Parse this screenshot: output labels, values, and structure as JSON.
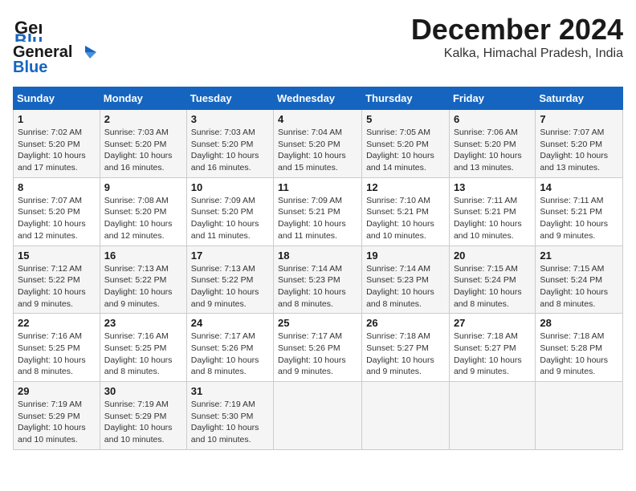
{
  "header": {
    "logo_line1": "General",
    "logo_line2": "Blue",
    "month": "December 2024",
    "location": "Kalka, Himachal Pradesh, India"
  },
  "weekdays": [
    "Sunday",
    "Monday",
    "Tuesday",
    "Wednesday",
    "Thursday",
    "Friday",
    "Saturday"
  ],
  "weeks": [
    [
      {
        "day": "1",
        "info": "Sunrise: 7:02 AM\nSunset: 5:20 PM\nDaylight: 10 hours\nand 17 minutes."
      },
      {
        "day": "2",
        "info": "Sunrise: 7:03 AM\nSunset: 5:20 PM\nDaylight: 10 hours\nand 16 minutes."
      },
      {
        "day": "3",
        "info": "Sunrise: 7:03 AM\nSunset: 5:20 PM\nDaylight: 10 hours\nand 16 minutes."
      },
      {
        "day": "4",
        "info": "Sunrise: 7:04 AM\nSunset: 5:20 PM\nDaylight: 10 hours\nand 15 minutes."
      },
      {
        "day": "5",
        "info": "Sunrise: 7:05 AM\nSunset: 5:20 PM\nDaylight: 10 hours\nand 14 minutes."
      },
      {
        "day": "6",
        "info": "Sunrise: 7:06 AM\nSunset: 5:20 PM\nDaylight: 10 hours\nand 13 minutes."
      },
      {
        "day": "7",
        "info": "Sunrise: 7:07 AM\nSunset: 5:20 PM\nDaylight: 10 hours\nand 13 minutes."
      }
    ],
    [
      {
        "day": "8",
        "info": "Sunrise: 7:07 AM\nSunset: 5:20 PM\nDaylight: 10 hours\nand 12 minutes."
      },
      {
        "day": "9",
        "info": "Sunrise: 7:08 AM\nSunset: 5:20 PM\nDaylight: 10 hours\nand 12 minutes."
      },
      {
        "day": "10",
        "info": "Sunrise: 7:09 AM\nSunset: 5:20 PM\nDaylight: 10 hours\nand 11 minutes."
      },
      {
        "day": "11",
        "info": "Sunrise: 7:09 AM\nSunset: 5:21 PM\nDaylight: 10 hours\nand 11 minutes."
      },
      {
        "day": "12",
        "info": "Sunrise: 7:10 AM\nSunset: 5:21 PM\nDaylight: 10 hours\nand 10 minutes."
      },
      {
        "day": "13",
        "info": "Sunrise: 7:11 AM\nSunset: 5:21 PM\nDaylight: 10 hours\nand 10 minutes."
      },
      {
        "day": "14",
        "info": "Sunrise: 7:11 AM\nSunset: 5:21 PM\nDaylight: 10 hours\nand 9 minutes."
      }
    ],
    [
      {
        "day": "15",
        "info": "Sunrise: 7:12 AM\nSunset: 5:22 PM\nDaylight: 10 hours\nand 9 minutes."
      },
      {
        "day": "16",
        "info": "Sunrise: 7:13 AM\nSunset: 5:22 PM\nDaylight: 10 hours\nand 9 minutes."
      },
      {
        "day": "17",
        "info": "Sunrise: 7:13 AM\nSunset: 5:22 PM\nDaylight: 10 hours\nand 9 minutes."
      },
      {
        "day": "18",
        "info": "Sunrise: 7:14 AM\nSunset: 5:23 PM\nDaylight: 10 hours\nand 8 minutes."
      },
      {
        "day": "19",
        "info": "Sunrise: 7:14 AM\nSunset: 5:23 PM\nDaylight: 10 hours\nand 8 minutes."
      },
      {
        "day": "20",
        "info": "Sunrise: 7:15 AM\nSunset: 5:24 PM\nDaylight: 10 hours\nand 8 minutes."
      },
      {
        "day": "21",
        "info": "Sunrise: 7:15 AM\nSunset: 5:24 PM\nDaylight: 10 hours\nand 8 minutes."
      }
    ],
    [
      {
        "day": "22",
        "info": "Sunrise: 7:16 AM\nSunset: 5:25 PM\nDaylight: 10 hours\nand 8 minutes."
      },
      {
        "day": "23",
        "info": "Sunrise: 7:16 AM\nSunset: 5:25 PM\nDaylight: 10 hours\nand 8 minutes."
      },
      {
        "day": "24",
        "info": "Sunrise: 7:17 AM\nSunset: 5:26 PM\nDaylight: 10 hours\nand 8 minutes."
      },
      {
        "day": "25",
        "info": "Sunrise: 7:17 AM\nSunset: 5:26 PM\nDaylight: 10 hours\nand 9 minutes."
      },
      {
        "day": "26",
        "info": "Sunrise: 7:18 AM\nSunset: 5:27 PM\nDaylight: 10 hours\nand 9 minutes."
      },
      {
        "day": "27",
        "info": "Sunrise: 7:18 AM\nSunset: 5:27 PM\nDaylight: 10 hours\nand 9 minutes."
      },
      {
        "day": "28",
        "info": "Sunrise: 7:18 AM\nSunset: 5:28 PM\nDaylight: 10 hours\nand 9 minutes."
      }
    ],
    [
      {
        "day": "29",
        "info": "Sunrise: 7:19 AM\nSunset: 5:29 PM\nDaylight: 10 hours\nand 10 minutes."
      },
      {
        "day": "30",
        "info": "Sunrise: 7:19 AM\nSunset: 5:29 PM\nDaylight: 10 hours\nand 10 minutes."
      },
      {
        "day": "31",
        "info": "Sunrise: 7:19 AM\nSunset: 5:30 PM\nDaylight: 10 hours\nand 10 minutes."
      },
      {
        "day": "",
        "info": ""
      },
      {
        "day": "",
        "info": ""
      },
      {
        "day": "",
        "info": ""
      },
      {
        "day": "",
        "info": ""
      }
    ]
  ]
}
